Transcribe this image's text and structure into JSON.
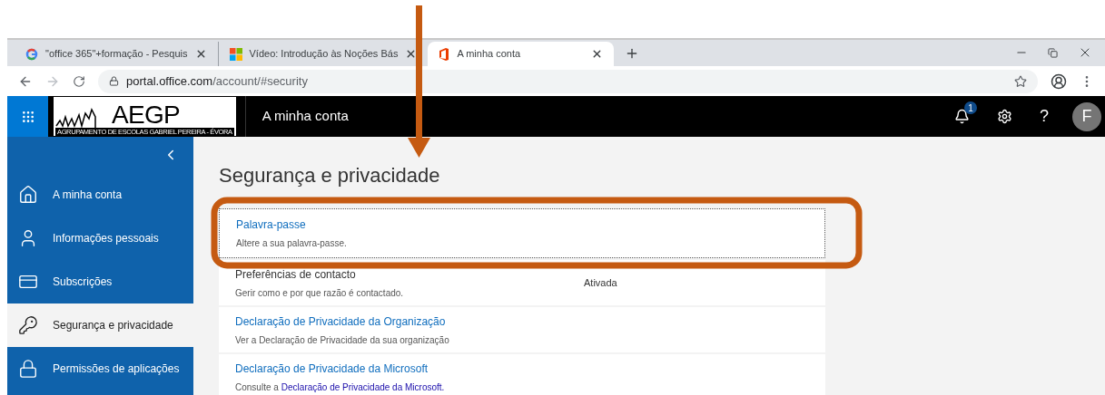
{
  "browser": {
    "tabs": [
      {
        "kind": "google",
        "title": "\"office 365\"+formação - Pesquis",
        "selected": false
      },
      {
        "kind": "microsoft",
        "title": "Vídeo: Introdução às Noções Bás",
        "selected": false
      },
      {
        "kind": "office",
        "title": "A minha conta",
        "selected": true
      }
    ],
    "url_host": "portal.office.com",
    "url_path": "/account/#security"
  },
  "header": {
    "logo_text": "AEGP",
    "logo_caption": "AGRUPAMENTO DE ESCOLAS GABRIEL PEREIRA - ÉVORA",
    "title": "A minha conta",
    "notification_count": "1",
    "avatar": "F",
    "help_label": "?"
  },
  "sidebar": {
    "items": [
      {
        "kind": "home",
        "label": "A minha conta",
        "selected": false
      },
      {
        "kind": "user",
        "label": "Informações pessoais",
        "selected": false
      },
      {
        "kind": "card",
        "label": "Subscrições",
        "selected": false
      },
      {
        "kind": "key",
        "label": "Segurança e privacidade",
        "selected": true
      },
      {
        "kind": "lock",
        "label": "Permissões de aplicações",
        "selected": false
      }
    ]
  },
  "page": {
    "heading": "Segurança e privacidade",
    "rows": [
      {
        "title": "Palavra-passe",
        "link": true,
        "description": "Altere a sua palavra-passe.",
        "focused": true
      },
      {
        "title": "Preferências de contacto",
        "link": false,
        "description": "Gerir como e por que razão é contactado.",
        "status": "Ativada",
        "focused": false
      },
      {
        "title": "Declaração de Privacidade da Organização",
        "link": true,
        "description": "Ver a Declaração de Privacidade da sua organização",
        "focused": false
      },
      {
        "title": "Declaração de Privacidade da Microsoft",
        "link": true,
        "description": "Consulte a",
        "description_link": "Declaração de Privacidade da Microsoft.",
        "focused": false
      }
    ]
  }
}
